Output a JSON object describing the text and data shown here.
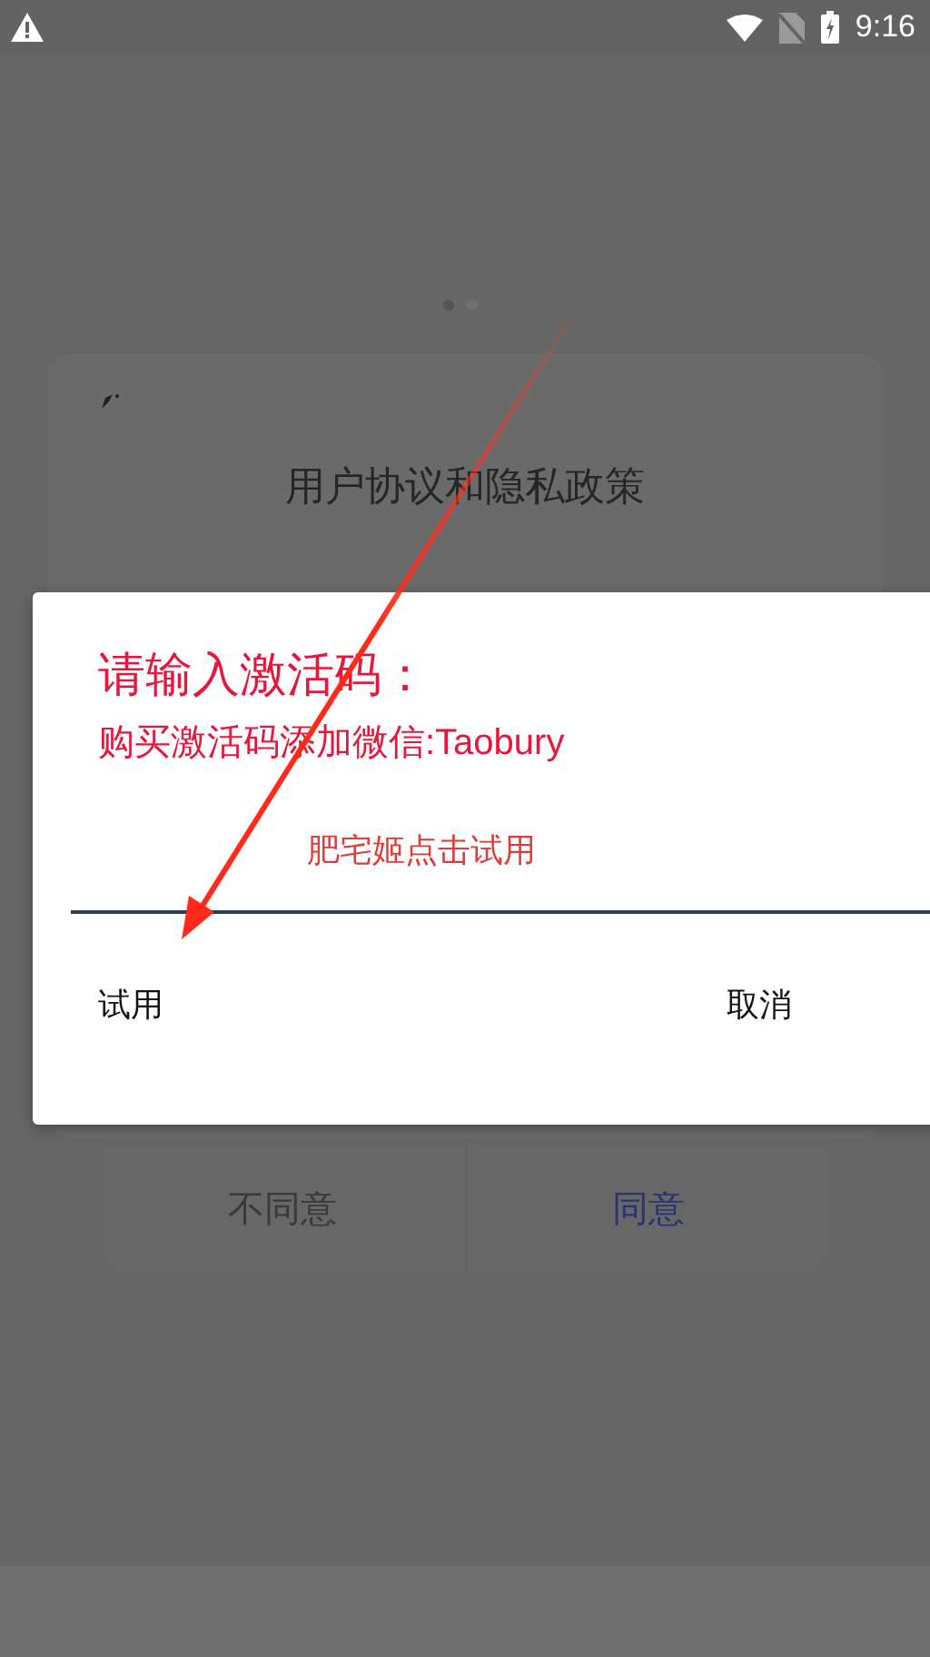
{
  "status_bar": {
    "time": "9:16"
  },
  "background": {
    "pager_dots": [
      {
        "selected": true
      },
      {
        "selected": false
      }
    ],
    "title": "用户协议和隐私政策",
    "buttons": [
      {
        "label": "不同意",
        "kind": "secondary"
      },
      {
        "label": "同意",
        "kind": "primary"
      }
    ]
  },
  "dialog": {
    "title": "请输入激活码：",
    "subtitle": "购买激活码添加微信:Taobury",
    "input": {
      "placeholder": "肥宅姬点击试用"
    },
    "buttons": [
      {
        "label": "试用"
      },
      {
        "label": "取消"
      }
    ]
  }
}
